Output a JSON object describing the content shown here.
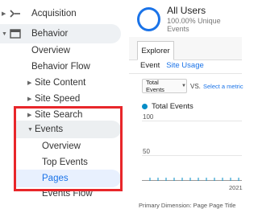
{
  "sidebar": {
    "acquisition": "Acquisition",
    "behavior": "Behavior",
    "items": {
      "overview": "Overview",
      "behavior_flow": "Behavior Flow",
      "site_content": "Site Content",
      "site_speed": "Site Speed",
      "site_search": "Site Search",
      "events": "Events",
      "events_overview": "Overview",
      "top_events": "Top Events",
      "pages": "Pages",
      "events_flow": "Events Flow"
    }
  },
  "segment": {
    "title": "All Users",
    "subtitle": "100.00% Unique Events"
  },
  "tabs": {
    "explorer": "Explorer"
  },
  "subtabs": {
    "event": "Event",
    "site_usage": "Site Usage"
  },
  "controls": {
    "metric": "Total Events",
    "vs": "VS.",
    "select_metric": "Select a metric"
  },
  "chart_data": {
    "type": "line",
    "series": [
      {
        "name": "Total Events",
        "values": []
      }
    ],
    "yticks": [
      "100",
      "50"
    ],
    "xticks": [
      "2021"
    ],
    "color": "#058dc7"
  },
  "footer": {
    "text": "Primary Dimension: Page  Page Title"
  }
}
